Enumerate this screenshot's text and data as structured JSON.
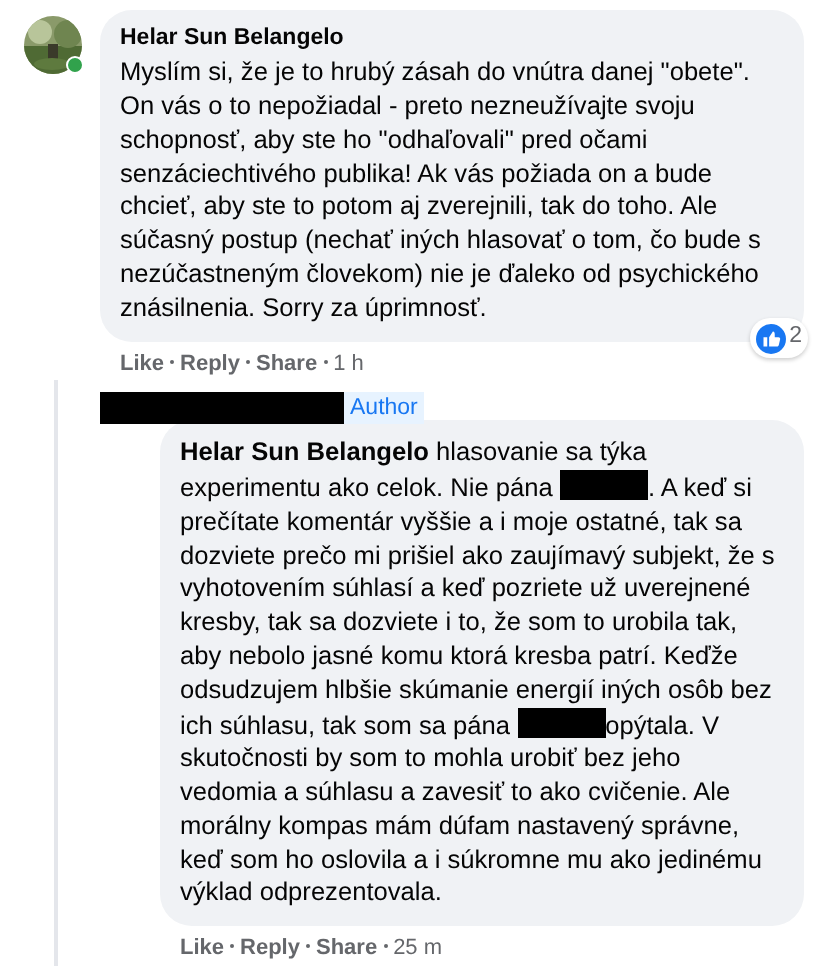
{
  "comment": {
    "author": "Helar Sun Belangelo",
    "online": true,
    "text": "Myslím si, že je to hrubý zásah do vnútra danej \"obete\". On vás o to nepožiadal - preto nezneužívajte svoju schopnosť, aby ste ho \"odhaľovali\" pred očami senzáciechtivého publika! Ak vás požiada on a bude chcieť, aby ste to potom aj zverejnili, tak do toho. Ale súčasný postup (nechať iných hlasovať o tom, čo bude s nezúčastneným človekom) nie je ďaleko od psychického znásilnenia. Sorry za úprimnosť.",
    "actions": [
      "Like",
      "Reply",
      "Share"
    ],
    "time": "1 h",
    "reaction_count": "2"
  },
  "reply": {
    "header_redacted": true,
    "badge": "Author",
    "segments": [
      {
        "kind": "mention",
        "text": "Helar Sun Belangelo"
      },
      {
        "kind": "text",
        "text": " hlasovanie sa týka experimentu ako celok. Nie pána "
      },
      {
        "kind": "redacted"
      },
      {
        "kind": "text",
        "text": ". A keď si prečítate komentár vyššie a i moje ostatné, tak sa dozviete prečo mi prišiel ako zaujímavý subjekt, že s vyhotovením súhlasí a keď pozriete už uverejnené kresby, tak sa dozviete i to, že som to urobila tak, aby nebolo jasné komu ktorá kresba patrí. Keďže odsudzujem hlbšie skúmanie energií iných osôb bez ich súhlasu, tak som sa pána "
      },
      {
        "kind": "redacted"
      },
      {
        "kind": "text",
        "text": "opýtala. V skutočnosti by som to mohla urobiť bez jeho vedomia a súhlasu a zavesiť to ako cvičenie. Ale morálny kompas mám dúfam nastavený správne, keď som ho oslovila a i súkromne mu ako jedinému výklad odprezentovala."
      }
    ],
    "actions": [
      "Like",
      "Reply",
      "Share"
    ],
    "time": "25 m"
  }
}
